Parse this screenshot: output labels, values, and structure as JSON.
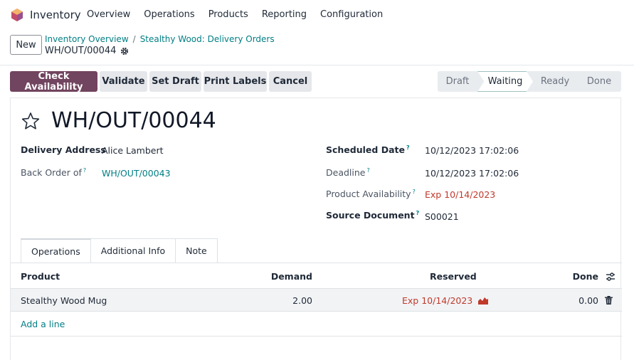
{
  "navbar": {
    "app_name": "Inventory",
    "menu": [
      "Overview",
      "Operations",
      "Products",
      "Reporting",
      "Configuration"
    ]
  },
  "control": {
    "new_label": "New",
    "breadcrumb": [
      "Inventory Overview",
      "Stealthy Wood: Delivery Orders"
    ],
    "record_name": "WH/OUT/00044"
  },
  "actions": {
    "check_availability": "Check Availability",
    "validate": "Validate",
    "set_draft": "Set Draft",
    "print_labels": "Print Labels",
    "cancel": "Cancel"
  },
  "status": {
    "stages": [
      "Draft",
      "Waiting",
      "Ready",
      "Done"
    ],
    "current": "Waiting"
  },
  "form": {
    "title": "WH/OUT/00044",
    "delivery_address_label": "Delivery Address",
    "delivery_address": "Alice Lambert",
    "back_order_label": "Back Order of",
    "back_order": "WH/OUT/00043",
    "scheduled_date_label": "Scheduled Date",
    "scheduled_date": "10/12/2023 17:02:06",
    "deadline_label": "Deadline",
    "deadline": "10/12/2023 17:02:06",
    "product_availability_label": "Product Availability",
    "product_availability": "Exp 10/14/2023",
    "source_document_label": "Source Document",
    "source_document": "S00021",
    "help_mark": "?"
  },
  "tabs": [
    "Operations",
    "Additional Info",
    "Note"
  ],
  "table": {
    "headers": {
      "product": "Product",
      "demand": "Demand",
      "reserved": "Reserved",
      "done": "Done"
    },
    "rows": [
      {
        "product": "Stealthy Wood Mug",
        "demand": "2.00",
        "reserved": "Exp 10/14/2023",
        "done": "0.00"
      }
    ],
    "add_line": "Add a line"
  },
  "colors": {
    "primary": "#71445f",
    "link": "#017e84",
    "danger": "#c0392b"
  },
  "icons": {
    "logo": "inventory-logo-icon",
    "gear": "gear-icon",
    "star": "star-icon",
    "forecast": "forecast-chart-icon",
    "settings": "optional-columns-icon",
    "trash": "trash-icon"
  }
}
